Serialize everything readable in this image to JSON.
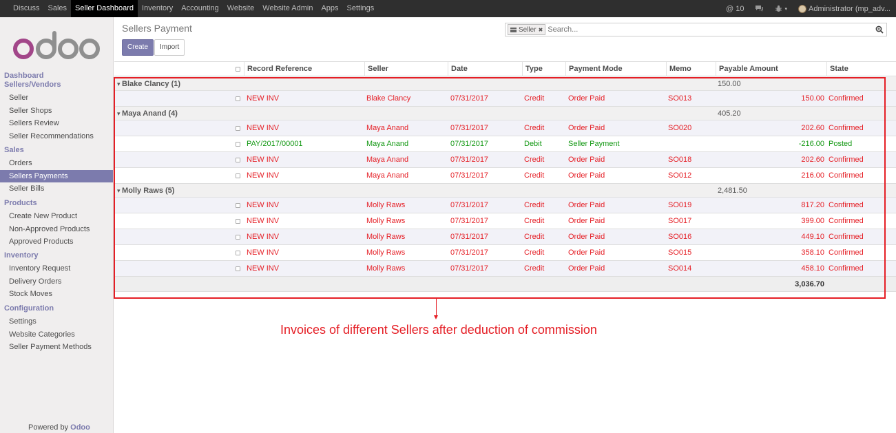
{
  "topbar": {
    "menu": [
      "Discuss",
      "Sales",
      "Seller Dashboard",
      "Inventory",
      "Accounting",
      "Website",
      "Website Admin",
      "Apps",
      "Settings"
    ],
    "active_index": 2,
    "notifications": "10",
    "user": "Administrator (mp_adv..."
  },
  "sidebar": {
    "sections": [
      {
        "title": "Dashboard",
        "items": []
      },
      {
        "title": "Sellers/Vendors",
        "items": [
          "Seller",
          "Seller Shops",
          "Sellers Review",
          "Seller Recommendations"
        ]
      },
      {
        "title": "Sales",
        "items": [
          "Orders",
          "Sellers Payments",
          "Seller Bills"
        ]
      },
      {
        "title": "Products",
        "items": [
          "Create New Product",
          "Non-Approved Products",
          "Approved Products"
        ]
      },
      {
        "title": "Inventory",
        "items": [
          "Inventory Request",
          "Delivery Orders",
          "Stock Moves"
        ]
      },
      {
        "title": "Configuration",
        "items": [
          "Settings",
          "Website Categories",
          "Seller Payment Methods"
        ]
      }
    ],
    "active_item": "Sellers Payments",
    "powered_by": "Powered by",
    "powered_brand": "Odoo",
    "logo_text": "odoo"
  },
  "control": {
    "title": "Sellers Payment",
    "create_label": "Create",
    "import_label": "Import",
    "facet_label": "Seller",
    "facet_remove": "✖",
    "search_placeholder": "Search..."
  },
  "table": {
    "columns": [
      "Record Reference",
      "Seller",
      "Date",
      "Type",
      "Payment Mode",
      "Memo",
      "Payable Amount",
      "State"
    ],
    "groups": [
      {
        "name": "Blake Clancy (1)",
        "total": "150.00",
        "rows": [
          {
            "ref": "NEW INV",
            "seller": "Blake Clancy",
            "date": "07/31/2017",
            "type": "Credit",
            "mode": "Order Paid",
            "memo": "SO013",
            "amount": "150.00",
            "state": "Confirmed",
            "color": "red"
          }
        ]
      },
      {
        "name": "Maya Anand (4)",
        "total": "405.20",
        "rows": [
          {
            "ref": "NEW INV",
            "seller": "Maya Anand",
            "date": "07/31/2017",
            "type": "Credit",
            "mode": "Order Paid",
            "memo": "SO020",
            "amount": "202.60",
            "state": "Confirmed",
            "color": "red"
          },
          {
            "ref": "PAY/2017/00001",
            "seller": "Maya Anand",
            "date": "07/31/2017",
            "type": "Debit",
            "mode": "Seller Payment",
            "memo": "",
            "amount": "-216.00",
            "state": "Posted",
            "color": "green"
          },
          {
            "ref": "NEW INV",
            "seller": "Maya Anand",
            "date": "07/31/2017",
            "type": "Credit",
            "mode": "Order Paid",
            "memo": "SO018",
            "amount": "202.60",
            "state": "Confirmed",
            "color": "red"
          },
          {
            "ref": "NEW INV",
            "seller": "Maya Anand",
            "date": "07/31/2017",
            "type": "Credit",
            "mode": "Order Paid",
            "memo": "SO012",
            "amount": "216.00",
            "state": "Confirmed",
            "color": "red"
          }
        ]
      },
      {
        "name": "Molly Raws (5)",
        "total": "2,481.50",
        "rows": [
          {
            "ref": "NEW INV",
            "seller": "Molly Raws",
            "date": "07/31/2017",
            "type": "Credit",
            "mode": "Order Paid",
            "memo": "SO019",
            "amount": "817.20",
            "state": "Confirmed",
            "color": "red"
          },
          {
            "ref": "NEW INV",
            "seller": "Molly Raws",
            "date": "07/31/2017",
            "type": "Credit",
            "mode": "Order Paid",
            "memo": "SO017",
            "amount": "399.00",
            "state": "Confirmed",
            "color": "red"
          },
          {
            "ref": "NEW INV",
            "seller": "Molly Raws",
            "date": "07/31/2017",
            "type": "Credit",
            "mode": "Order Paid",
            "memo": "SO016",
            "amount": "449.10",
            "state": "Confirmed",
            "color": "red"
          },
          {
            "ref": "NEW INV",
            "seller": "Molly Raws",
            "date": "07/31/2017",
            "type": "Credit",
            "mode": "Order Paid",
            "memo": "SO015",
            "amount": "358.10",
            "state": "Confirmed",
            "color": "red"
          },
          {
            "ref": "NEW INV",
            "seller": "Molly Raws",
            "date": "07/31/2017",
            "type": "Credit",
            "mode": "Order Paid",
            "memo": "SO014",
            "amount": "458.10",
            "state": "Confirmed",
            "color": "red"
          }
        ]
      }
    ],
    "grand_total": "3,036.70"
  },
  "annotation": {
    "text": "Invoices of different Sellers after deduction of commission"
  },
  "colors": {
    "accent": "#7c7bad",
    "credit": "#e51e25",
    "debit": "#139813",
    "annotation": "#e51e25"
  }
}
